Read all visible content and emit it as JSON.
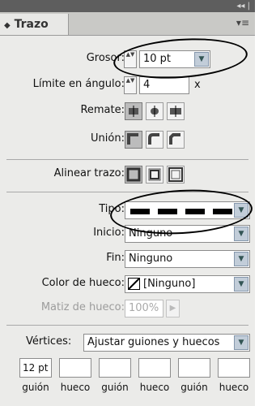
{
  "panel": {
    "title": "Trazo",
    "tab_arrow": "◆",
    "collapse_glyph": "◂◂ |",
    "menu_glyph": "▾≡"
  },
  "grosor": {
    "label": "Grosor:",
    "value": "10 pt"
  },
  "limite": {
    "label": "Límite en ángulo:",
    "value": "4",
    "suffix": "x"
  },
  "remate": {
    "label": "Remate:"
  },
  "union": {
    "label": "Unión:"
  },
  "alinear": {
    "label": "Alinear trazo:"
  },
  "tipo": {
    "label": "Tipo:"
  },
  "inicio": {
    "label": "Inicio:",
    "value": "Ninguno"
  },
  "fin": {
    "label": "Fin:",
    "value": "Ninguno"
  },
  "color_hueco": {
    "label": "Color de hueco:",
    "value": "[Ninguno]"
  },
  "matiz_hueco": {
    "label": "Matiz de hueco:",
    "value": "100%"
  },
  "vertices": {
    "label": "Vértices:",
    "value": "Ajustar guiones y huecos"
  },
  "dash_gap": {
    "fields": [
      "12 pt",
      "",
      "",
      "",
      "",
      ""
    ],
    "labels": [
      "guión",
      "hueco",
      "guión",
      "hueco",
      "guión",
      "hueco"
    ]
  },
  "dropdown_arrow": "▼",
  "spinner_glyph": "▲▼"
}
